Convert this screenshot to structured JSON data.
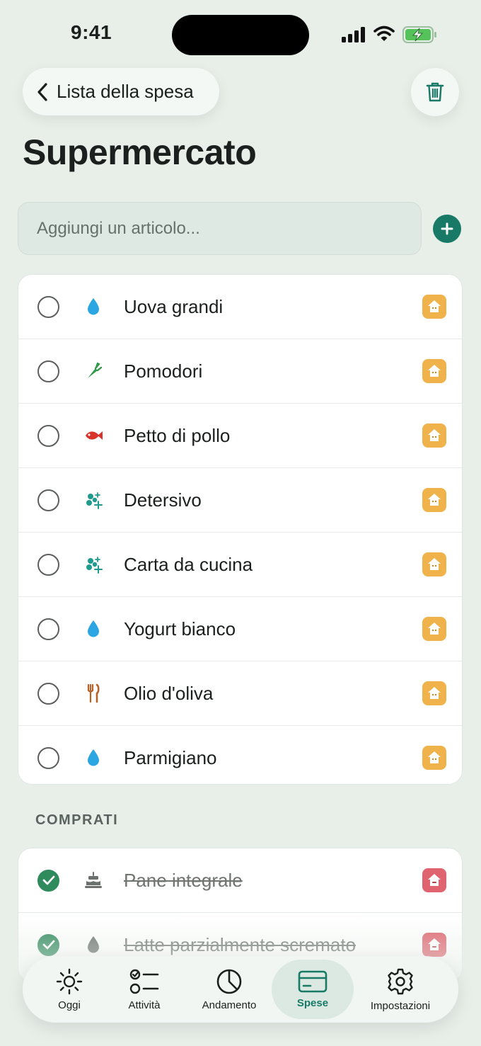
{
  "status": {
    "time": "9:41"
  },
  "header": {
    "back_label": "Lista della spesa",
    "title": "Supermercato"
  },
  "add": {
    "placeholder": "Aggiungi un articolo..."
  },
  "items": [
    {
      "name": "Uova grandi",
      "icon": "water-drop-icon"
    },
    {
      "name": "Pomodori",
      "icon": "carrot-icon"
    },
    {
      "name": "Petto di pollo",
      "icon": "fish-icon"
    },
    {
      "name": "Detersivo",
      "icon": "sparkles-icon"
    },
    {
      "name": "Carta da cucina",
      "icon": "sparkles-icon"
    },
    {
      "name": "Yogurt bianco",
      "icon": "water-drop-icon"
    },
    {
      "name": "Olio d'oliva",
      "icon": "fork-knife-icon"
    },
    {
      "name": "Parmigiano",
      "icon": "water-drop-icon"
    }
  ],
  "bought": {
    "title": "COMPRATI",
    "items": [
      {
        "name": "Pane integrale",
        "icon": "cake-icon"
      },
      {
        "name": "Latte parzialmente scremato",
        "icon": "water-drop-icon"
      }
    ]
  },
  "tabs": [
    {
      "label": "Oggi",
      "icon": "sun-icon"
    },
    {
      "label": "Attività",
      "icon": "checklist-icon"
    },
    {
      "label": "Andamento",
      "icon": "pie-chart-icon"
    },
    {
      "label": "Spese",
      "icon": "card-icon",
      "active": true
    },
    {
      "label": "Impostazioni",
      "icon": "gear-icon"
    }
  ],
  "colors": {
    "accent": "#187a66",
    "badge_orange": "#f0b24a",
    "badge_red": "#e06470",
    "check": "#2f8a5c"
  }
}
